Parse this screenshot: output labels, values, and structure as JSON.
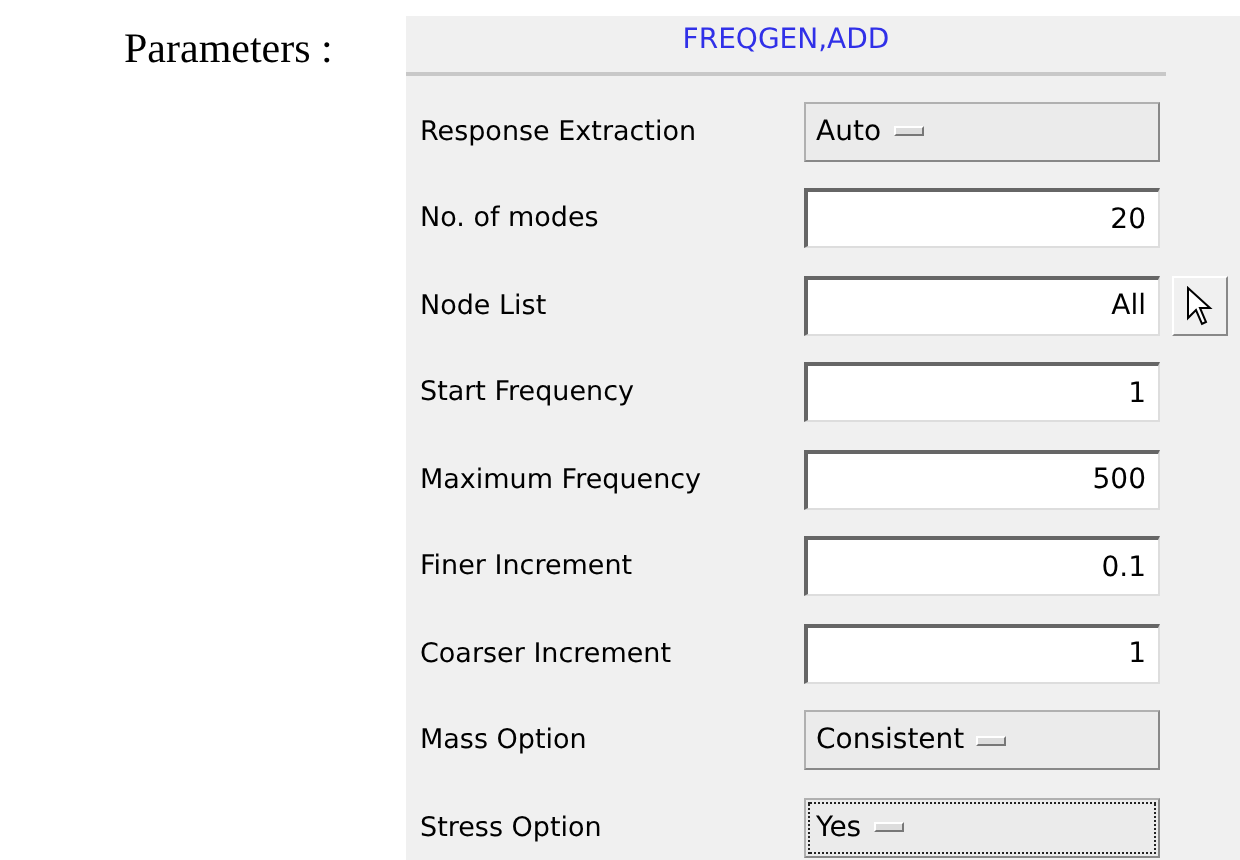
{
  "heading": "Parameters :",
  "dialog": {
    "title": "FREQGEN,ADD",
    "rows": [
      {
        "kind": "option",
        "label": "Response Extraction",
        "value": "Auto",
        "focused": false
      },
      {
        "kind": "field",
        "label": "No. of modes",
        "value": "20"
      },
      {
        "kind": "field",
        "label": "Node List",
        "value": "All",
        "picker": true
      },
      {
        "kind": "field",
        "label": "Start Frequency",
        "value": "1"
      },
      {
        "kind": "field",
        "label": "Maximum Frequency",
        "value": "500"
      },
      {
        "kind": "field",
        "label": "Finer Increment",
        "value": "0.1"
      },
      {
        "kind": "field",
        "label": "Coarser Increment",
        "value": "1"
      },
      {
        "kind": "option",
        "label": "Mass Option",
        "value": "Consistent",
        "focused": false
      },
      {
        "kind": "option",
        "label": "Stress Option",
        "value": "Yes",
        "focused": true
      }
    ]
  }
}
